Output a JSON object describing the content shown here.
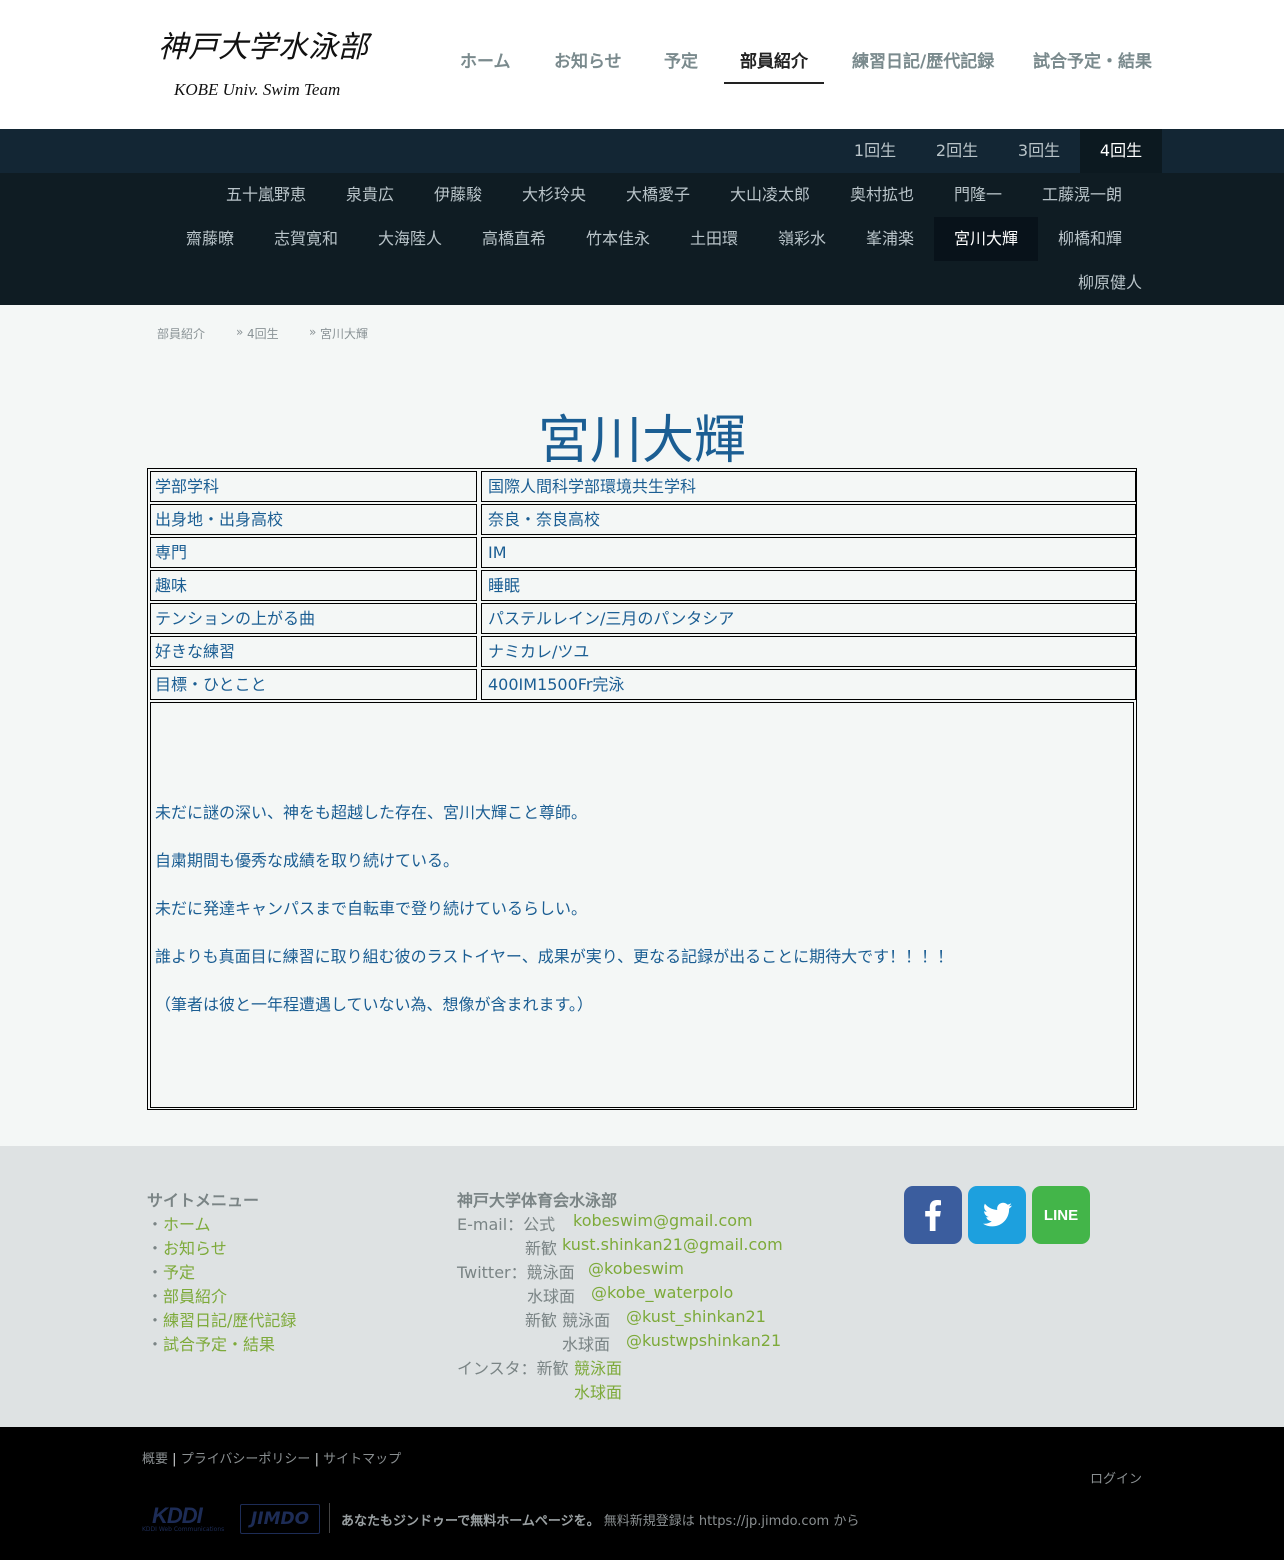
{
  "header": {
    "logo_title": "神戸大学水泳部",
    "logo_sub": "KOBE Univ. Swim Team",
    "nav": [
      "ホーム",
      "お知らせ",
      "予定",
      "部員紹介",
      "練習日記/歴代記録",
      "試合予定・結果"
    ],
    "active_nav": "部員紹介"
  },
  "grade_nav": {
    "items": [
      "1回生",
      "2回生",
      "3回生",
      "4回生"
    ],
    "active": "4回生"
  },
  "member_nav": {
    "row1": [
      "五十嵐野恵",
      "泉貴広",
      "伊藤駿",
      "大杉玲央",
      "大橋愛子",
      "大山凌太郎",
      "奥村拡也",
      "門隆一",
      "工藤滉一朗"
    ],
    "row2": [
      "齋藤暸",
      "志賀寛和",
      "大海陸人",
      "高橋直希",
      "竹本佳永",
      "土田環",
      "嶺彩水",
      "峯浦楽",
      "宮川大輝",
      "柳橋和輝"
    ],
    "row3": [
      "柳原健人"
    ],
    "active": "宮川大輝"
  },
  "breadcrumb": {
    "items": [
      "部員紹介",
      "4回生",
      "宮川大輝"
    ],
    "separator": "»"
  },
  "profile": {
    "name": "宮川大輝",
    "rows": [
      {
        "label": "学部学科",
        "value": "国際人間科学部環境共生学科"
      },
      {
        "label": "出身地・出身高校",
        "value": "奈良・奈良高校"
      },
      {
        "label": "専門",
        "value": "IM"
      },
      {
        "label": "趣味",
        "value": "睡眠"
      },
      {
        "label": "テンションの上がる曲",
        "value": "パステルレイン/三月のパンタシア"
      },
      {
        "label": "好きな練習",
        "value": "ナミカレ/ツユ"
      },
      {
        "label": "目標・ひとこと",
        "value": "400IM1500Fr完泳"
      }
    ],
    "message": [
      "未だに謎の深い、神をも超越した存在、宮川大輝こと尊師。",
      "自粛期間も優秀な成績を取り続けている。",
      "未だに発達キャンパスまで自転車で登り続けているらしい。",
      "誰よりも真面目に練習に取り組む彼のラストイヤー、成果が実り、更なる記録が出ることに期待大です！！！！",
      "（筆者は彼と一年程遭遇していない為、想像が含まれます。）"
    ]
  },
  "footer": {
    "menu_title": "サイトメニュー",
    "menu_bullet": "・",
    "menu": [
      "ホーム",
      "お知らせ",
      "予定",
      "部員紹介",
      "練習日記/歴代記録",
      "試合予定・結果"
    ],
    "org_title": "神戸大学体育会水泳部",
    "email_label": "E-mail：公式",
    "email_official": "kobeswim@gmail.com",
    "email_new_label": "新歓",
    "email_new": "kust.shinkan21@gmail.com",
    "twitter_label": "Twitter：競泳面",
    "twitter_swim": "@kobeswim",
    "twitter_wp_label": "水球面",
    "twitter_wp": "@kobe_waterpolo",
    "twitter_new_label": "新歓 競泳面",
    "twitter_new_swim": "@kust_shinkan21",
    "twitter_new_wp_label": "水球面",
    "twitter_new_wp": "@kustwpshinkan21",
    "insta_label": "インスタ：新歓",
    "insta_swim": "競泳面",
    "insta_wp": "水球面",
    "social": [
      {
        "name": "facebook",
        "glyph": "f",
        "color": "#3b5d9e"
      },
      {
        "name": "twitter",
        "glyph": "bird",
        "color": "#1da0de"
      },
      {
        "name": "line",
        "glyph": "LINE",
        "color": "#43b549"
      }
    ]
  },
  "bottom": {
    "legal": [
      "概要",
      "プライバシーポリシー",
      "サイトマップ"
    ],
    "legal_sep": "|",
    "login": "ログイン",
    "kddi_logo": "KDDI",
    "kddi_sub": "KDDI Web Communications",
    "jimdo_logo": "JIMDO",
    "promo_strong": "あなたもジンドゥーで無料ホームページを。",
    "promo_rest": " 無料新規登録は https://jp.jimdo.com から"
  }
}
